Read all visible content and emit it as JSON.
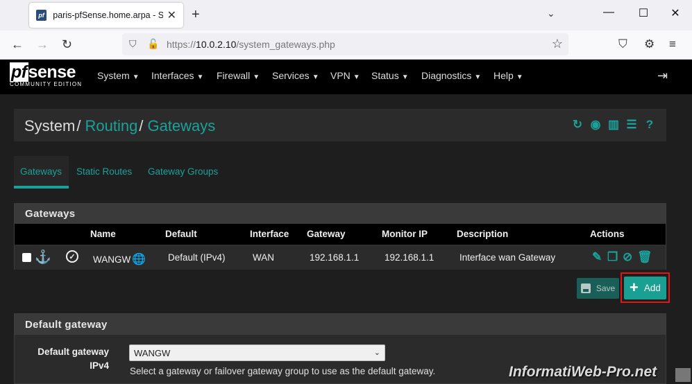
{
  "browser": {
    "tab_title": "paris-pfSense.home.arpa - System: Routing: Gateways",
    "favicon_text": "pf",
    "url_prefix": "https://",
    "url_host": "10.0.2.10",
    "url_path": "/system_gateways.php"
  },
  "pfsense": {
    "logo_text": "sense",
    "logo_pf": "pf",
    "logo_sub": "COMMUNITY EDITION",
    "menu": [
      "System",
      "Interfaces",
      "Firewall",
      "Services",
      "VPN",
      "Status",
      "Diagnostics",
      "Help"
    ]
  },
  "breadcrumb": {
    "root": "System",
    "level1": "Routing",
    "level2": "Gateways"
  },
  "tabs": [
    "Gateways",
    "Static Routes",
    "Gateway Groups"
  ],
  "gateways_panel": {
    "title": "Gateways",
    "columns": [
      "Name",
      "Default",
      "Interface",
      "Gateway",
      "Monitor IP",
      "Description",
      "Actions"
    ],
    "row": {
      "name": "WANGW",
      "default": "Default (IPv4)",
      "interface": "WAN",
      "gateway": "192.168.1.1",
      "monitor_ip": "192.168.1.1",
      "description": "Interface wan Gateway"
    }
  },
  "buttons": {
    "save": "Save",
    "add": "Add"
  },
  "default_gateway": {
    "title": "Default gateway",
    "label": "Default gateway IPv4",
    "value": "WANGW",
    "help": "Select a gateway or failover gateway group to use as the default gateway."
  },
  "watermark": "InformatiWeb-Pro.net",
  "colors": {
    "accent": "#1aa19a",
    "highlight": "#e01818"
  }
}
